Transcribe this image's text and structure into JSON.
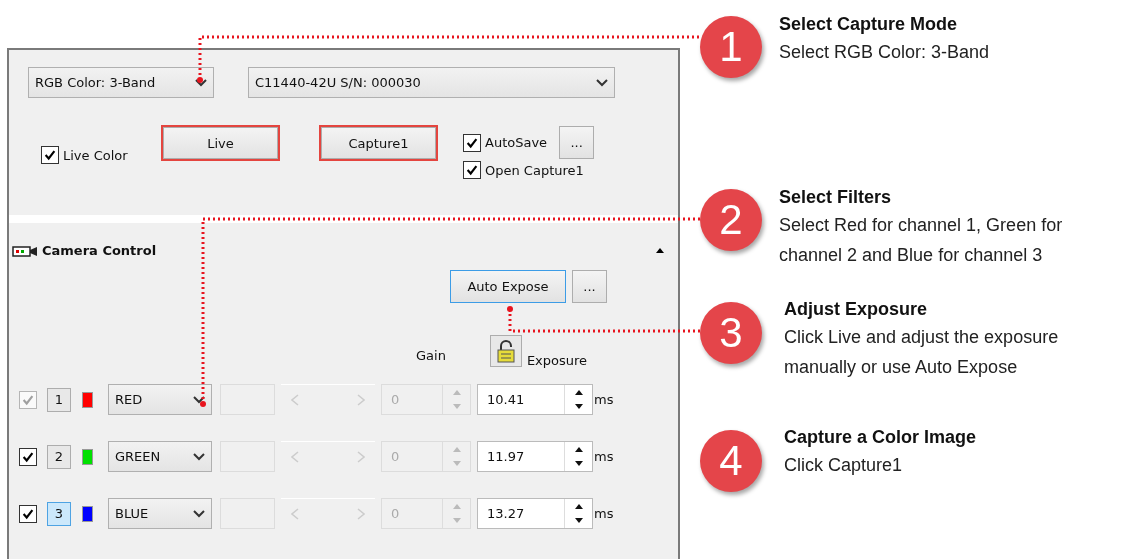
{
  "capture_mode": {
    "value": "RGB Color: 3-Band"
  },
  "camera_select": {
    "value": "C11440-42U S/N: 000030"
  },
  "live_color": {
    "label": "Live Color",
    "checked": true
  },
  "buttons": [
    {
      "label": "Live",
      "highlighted": true
    },
    {
      "label": "Capture1",
      "highlighted": true
    }
  ],
  "options": [
    {
      "label": "AutoSave",
      "checked": true,
      "more_button": "..."
    },
    {
      "label": "Open Capture1",
      "checked": true
    }
  ],
  "camera_control": {
    "title": "Camera Control",
    "expanded": true,
    "auto_expose": {
      "label": "Auto Expose",
      "focused": true
    },
    "more_button": "...",
    "gain_header": "Gain",
    "exposure_header": "Exposure",
    "channels": [
      {
        "checked": true,
        "disabled": true,
        "number": "1",
        "selected": false,
        "color": "#ff0000",
        "filter": "RED",
        "gain": "0",
        "exposure": "10.41",
        "unit": "ms"
      },
      {
        "checked": true,
        "disabled": false,
        "number": "2",
        "selected": false,
        "color": "#00e000",
        "filter": "GREEN",
        "gain": "0",
        "exposure": "11.97",
        "unit": "ms"
      },
      {
        "checked": true,
        "disabled": false,
        "number": "3",
        "selected": true,
        "color": "#0000ff",
        "filter": "BLUE",
        "gain": "0",
        "exposure": "13.27",
        "unit": "ms"
      }
    ]
  },
  "steps": [
    {
      "number": "1",
      "title": "Select Capture Mode",
      "text": "Select RGB Color: 3-Band"
    },
    {
      "number": "2",
      "title": "Select Filters",
      "text": "Select Red for channel 1, Green for channel 2 and Blue for channel 3"
    },
    {
      "number": "3",
      "title": "Adjust Exposure",
      "text": "Click Live and adjust the exposure manually or use Auto Expose"
    },
    {
      "number": "4",
      "title": "Capture a Color Image",
      "text": "Click Capture1"
    }
  ]
}
